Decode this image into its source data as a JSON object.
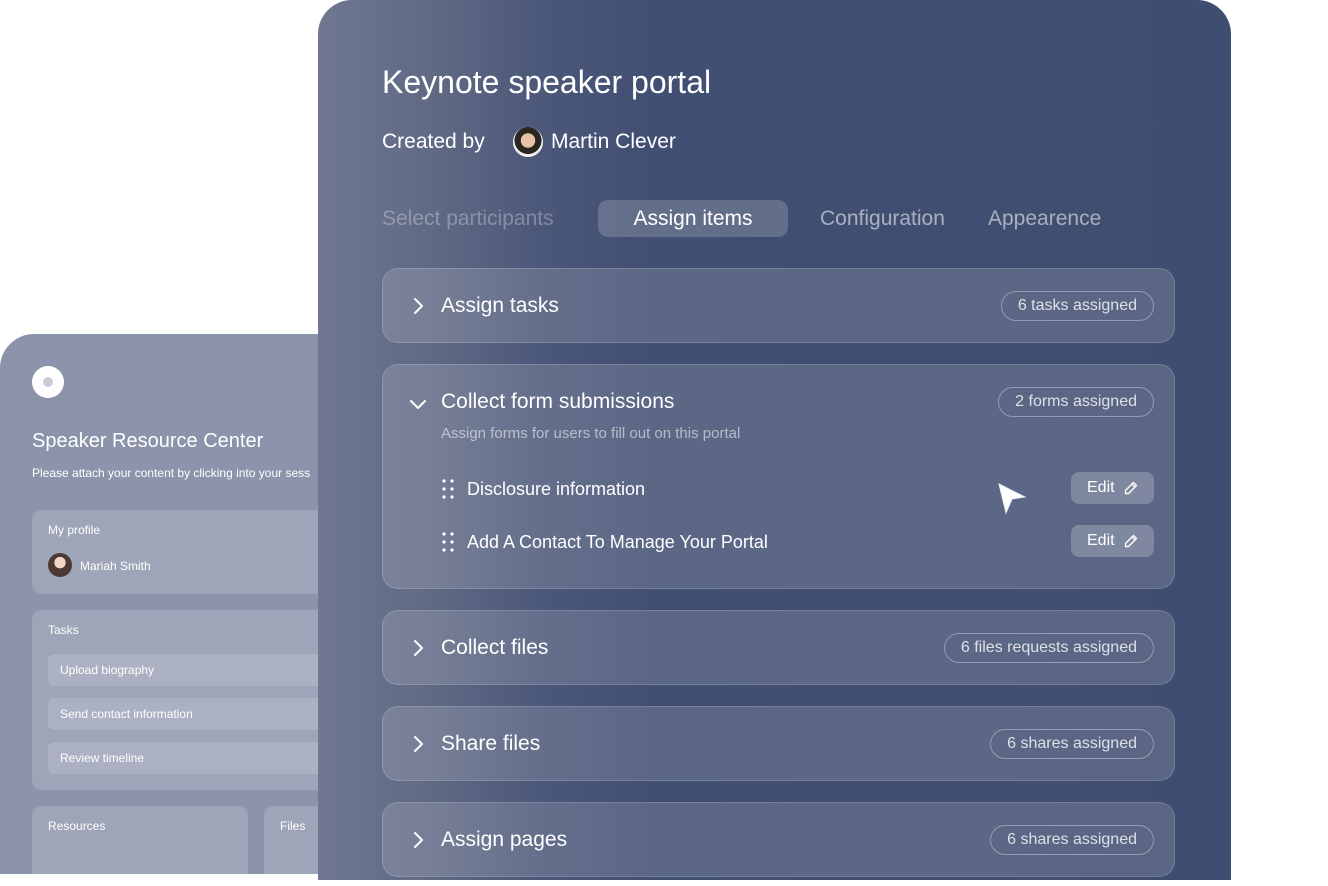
{
  "background_card": {
    "title": "Speaker Resource Center",
    "subtitle": "Please attach your content by clicking into your sess",
    "profile": {
      "label": "My profile",
      "user_name": "Mariah Smith"
    },
    "tasks": {
      "label": "Tasks",
      "items": [
        "Upload biography",
        "Send contact information",
        "Review timeline"
      ]
    },
    "resources_label": "Resources",
    "files_label": "Files"
  },
  "portal": {
    "title": "Keynote speaker portal",
    "created_by_label": "Created by",
    "creator_name": "Martin Clever",
    "tabs": [
      {
        "label": "Select participants",
        "state": "inactive"
      },
      {
        "label": "Assign items",
        "state": "active"
      },
      {
        "label": "Configuration",
        "state": "inactive"
      },
      {
        "label": "Appearence",
        "state": "inactive"
      }
    ],
    "sections": [
      {
        "title": "Assign tasks",
        "badge": "6 tasks assigned",
        "expanded": false
      },
      {
        "title": "Collect form submissions",
        "badge": "2  forms assigned",
        "expanded": true,
        "description": "Assign forms for users to fill out on this portal",
        "forms": [
          {
            "label": "Disclosure information",
            "action": "Edit"
          },
          {
            "label": "Add A Contact To Manage Your Portal",
            "action": "Edit"
          }
        ]
      },
      {
        "title": "Collect files",
        "badge": "6 files requests assigned",
        "expanded": false
      },
      {
        "title": "Share files",
        "badge": "6 shares assigned",
        "expanded": false
      },
      {
        "title": "Assign pages",
        "badge": "6 shares assigned",
        "expanded": false
      }
    ]
  },
  "icons": {
    "collapsed": "chevron-right-icon",
    "expanded": "chevron-down-icon",
    "drag": "drag-handle-icon",
    "edit": "pencil-icon",
    "cursor": "mouse-pointer-icon"
  },
  "colors": {
    "card_background": "#3f4d70",
    "back_card_background": "#8c94ab",
    "text_primary": "#ffffff"
  }
}
